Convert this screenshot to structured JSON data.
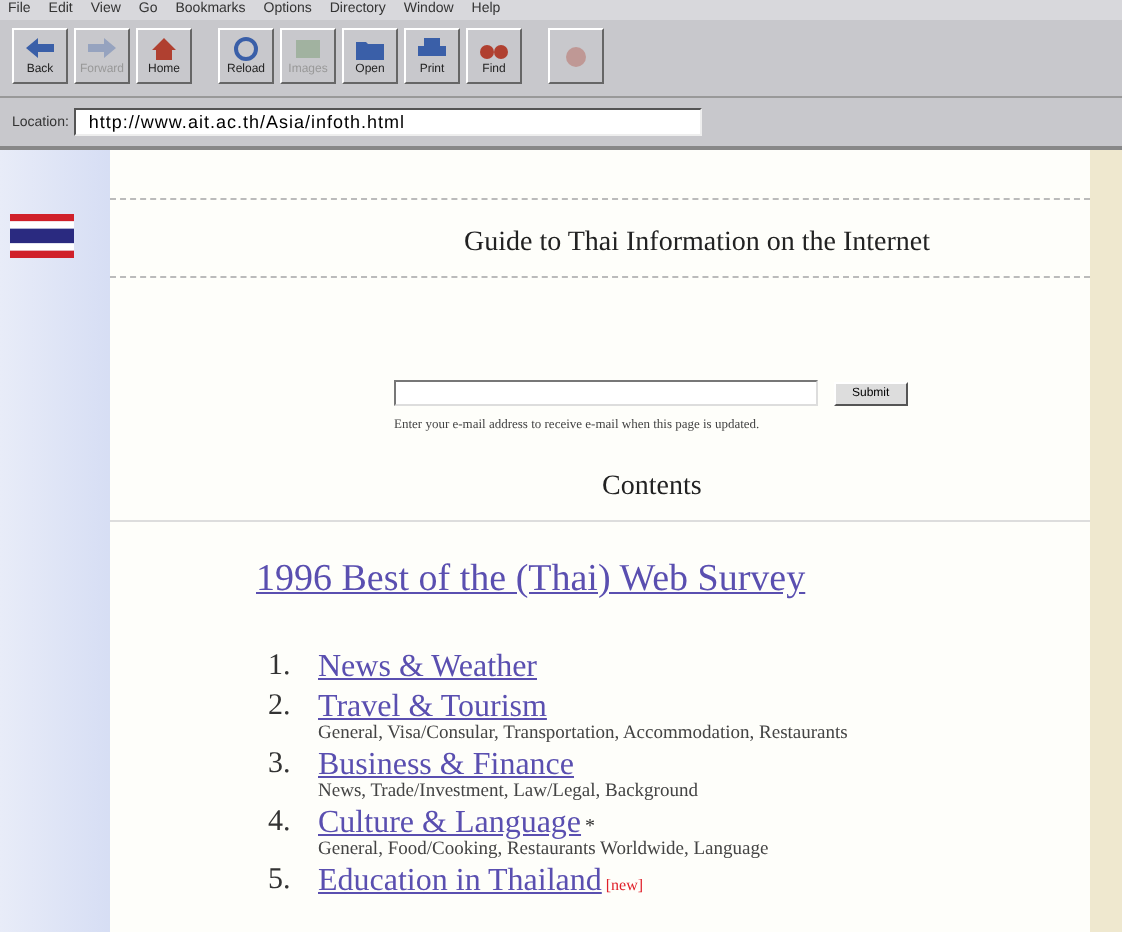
{
  "menu": [
    "File",
    "Edit",
    "View",
    "Go",
    "Bookmarks",
    "Options",
    "Directory",
    "Window",
    "Help"
  ],
  "toolbar": [
    {
      "kind": "back",
      "label": "Back",
      "disabled": false
    },
    {
      "kind": "forward",
      "label": "Forward",
      "disabled": true
    },
    {
      "kind": "home",
      "label": "Home",
      "disabled": false
    },
    {
      "kind": "reload",
      "label": "Reload",
      "disabled": false
    },
    {
      "kind": "images",
      "label": "Images",
      "disabled": true
    },
    {
      "kind": "open",
      "label": "Open",
      "disabled": false
    },
    {
      "kind": "print",
      "label": "Print",
      "disabled": false
    },
    {
      "kind": "find",
      "label": "Find",
      "disabled": false
    },
    {
      "kind": "stop",
      "disabled": true
    }
  ],
  "location": {
    "label": "Location:",
    "value": "http://www.ait.ac.th/Asia/infoth.html"
  },
  "page": {
    "title": "Guide to Thai Information on the Internet",
    "email": {
      "button": "Submit",
      "hint": "Enter your e-mail address to receive e-mail when this page is updated."
    },
    "contents_heading": "Contents",
    "survey_link": "1996 Best of the (Thai) Web Survey",
    "sections": [
      {
        "number": "1.",
        "title": "News & Weather"
      },
      {
        "number": "2.",
        "title": "Travel & Tourism",
        "subtopics": "General, Visa/Consular, Transportation, Accommodation, Restaurants"
      },
      {
        "number": "3.",
        "title": "Business & Finance",
        "subtopics": "News, Trade/Investment, Law/Legal, Background"
      },
      {
        "number": "4.",
        "title": "Culture & Language",
        "mark": "*",
        "subtopics": "General, Food/Cooking, Restaurants Worldwide, Language"
      },
      {
        "number": "5.",
        "title": "Education in Thailand",
        "badge": "[new]"
      }
    ]
  }
}
